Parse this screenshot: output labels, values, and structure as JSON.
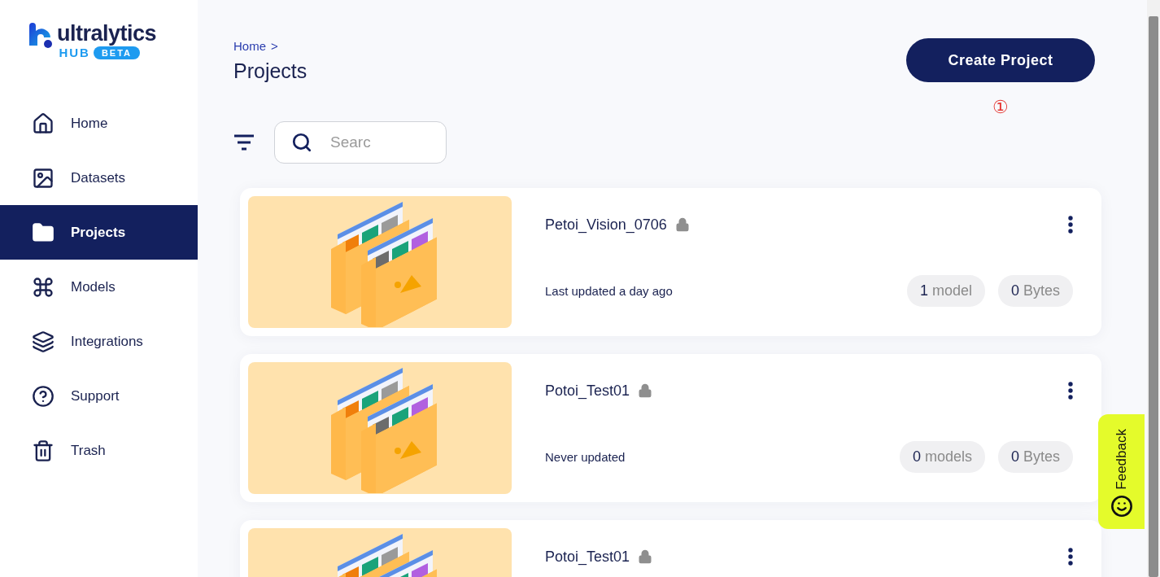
{
  "logo": {
    "name": "ultralytics",
    "product": "HUB",
    "badge": "BETA"
  },
  "sidebar": {
    "items": [
      {
        "label": "Home",
        "selected": false
      },
      {
        "label": "Datasets",
        "selected": false
      },
      {
        "label": "Projects",
        "selected": true
      },
      {
        "label": "Models",
        "selected": false
      },
      {
        "label": "Integrations",
        "selected": false
      },
      {
        "label": "Support",
        "selected": false
      },
      {
        "label": "Trash",
        "selected": false
      }
    ]
  },
  "breadcrumb": [
    "Home",
    ">"
  ],
  "page_title": "Projects",
  "create_button": "Create Project",
  "annotation": "①",
  "search": {
    "placeholder": "Searc"
  },
  "projects": [
    {
      "name": "Petoi_Vision_0706",
      "locked": true,
      "updated": "Last updated a day ago",
      "models_count": "1",
      "models_unit": "model",
      "size_count": "0",
      "size_unit": "Bytes"
    },
    {
      "name": "Potoi_Test01",
      "locked": true,
      "updated": "Never updated",
      "models_count": "0",
      "models_unit": "models",
      "size_count": "0",
      "size_unit": "Bytes"
    },
    {
      "name": "Potoi_Test01",
      "locked": true
    }
  ],
  "feedback": "Feedback"
}
